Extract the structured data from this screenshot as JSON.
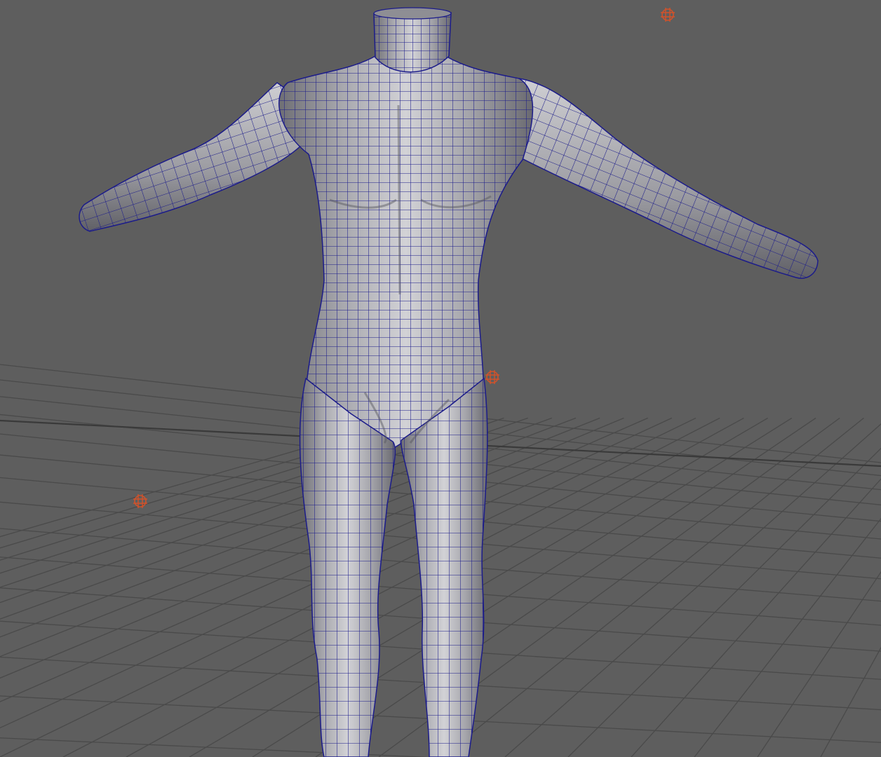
{
  "viewport": {
    "background_color": "#5e5e5e",
    "grid_color": "#4a4a4a",
    "grid_axis_color": "#3a3a3a",
    "mesh_fill_light": "#c8c8cc",
    "mesh_fill_dark": "#7a7a80",
    "wireframe_color": "#1c1c8a",
    "light_marker_color": "#d2522a"
  },
  "scene": {
    "object": "humanoid-body-mesh",
    "display_mode": "smooth-shaded-with-wireframe",
    "light_markers": [
      "point-light-icon",
      "point-light-icon",
      "point-light-icon"
    ]
  }
}
